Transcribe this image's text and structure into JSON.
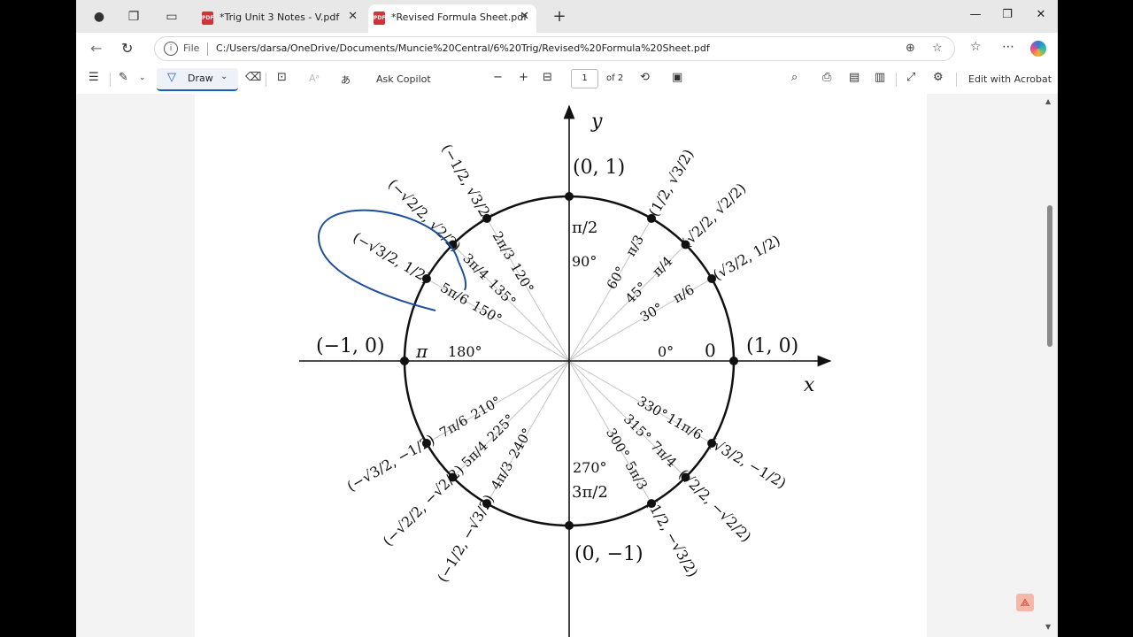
{
  "tabs": [
    {
      "title": "*Trig Unit 3 Notes - V.pdf",
      "active": false
    },
    {
      "title": "*Revised Formula Sheet.pdf",
      "active": true
    }
  ],
  "address": {
    "scheme": "File",
    "url": "C:/Users/darsa/OneDrive/Documents/Muncie%20Central/6%20Trig/Revised%20Formula%20Sheet.pdf"
  },
  "toolbar": {
    "draw_label": "Draw",
    "ask_copilot": "Ask Copilot",
    "page_number": "1",
    "page_total": "of 2",
    "edit_acrobat": "Edit with Acrobat"
  },
  "unit_circle": {
    "axis_x": "x",
    "axis_y": "y",
    "axis_points": [
      "(0, 1)",
      "(1, 0)",
      "(−1, 0)",
      "(0, −1)"
    ],
    "axis_angles": {
      "zero": "0",
      "zero_deg": "0°",
      "ninety_deg": "90°",
      "pi": "π",
      "one_eighty_deg": "180°",
      "two_seventy_deg": "270°"
    },
    "radians_top": {
      "pi_over_2": "π/2",
      "three_pi_over_2": "3π/2"
    },
    "angles": [
      {
        "deg": 30,
        "deg_label": "30°",
        "rad": "π/6",
        "coord": "(√3/2, 1/2)"
      },
      {
        "deg": 45,
        "deg_label": "45°",
        "rad": "π/4",
        "coord": "(√2/2, √2/2)"
      },
      {
        "deg": 60,
        "deg_label": "60°",
        "rad": "π/3",
        "coord": "(1/2, √3/2)"
      },
      {
        "deg": 120,
        "deg_label": "120°",
        "rad": "2π/3",
        "coord": "(−1/2, √3/2)"
      },
      {
        "deg": 135,
        "deg_label": "135°",
        "rad": "3π/4",
        "coord": "(−√2/2, √2/2)"
      },
      {
        "deg": 150,
        "deg_label": "150°",
        "rad": "5π/6",
        "coord": "(−√3/2, 1/2)"
      },
      {
        "deg": 210,
        "deg_label": "210°",
        "rad": "7π/6",
        "coord": "(−√3/2, −1/2)"
      },
      {
        "deg": 225,
        "deg_label": "225°",
        "rad": "5π/4",
        "coord": "(−√2/2, −√2/2)"
      },
      {
        "deg": 240,
        "deg_label": "240°",
        "rad": "4π/3",
        "coord": "(−1/2, −√3/2)"
      },
      {
        "deg": 300,
        "deg_label": "300°",
        "rad": "5π/3",
        "coord": "(1/2, −√3/2)"
      },
      {
        "deg": 315,
        "deg_label": "315°",
        "rad": "7π/4",
        "coord": "(√2/2, −√2/2)"
      },
      {
        "deg": 330,
        "deg_label": "330°",
        "rad": "11π/6",
        "coord": "(√3/2, −1/2)"
      }
    ]
  }
}
